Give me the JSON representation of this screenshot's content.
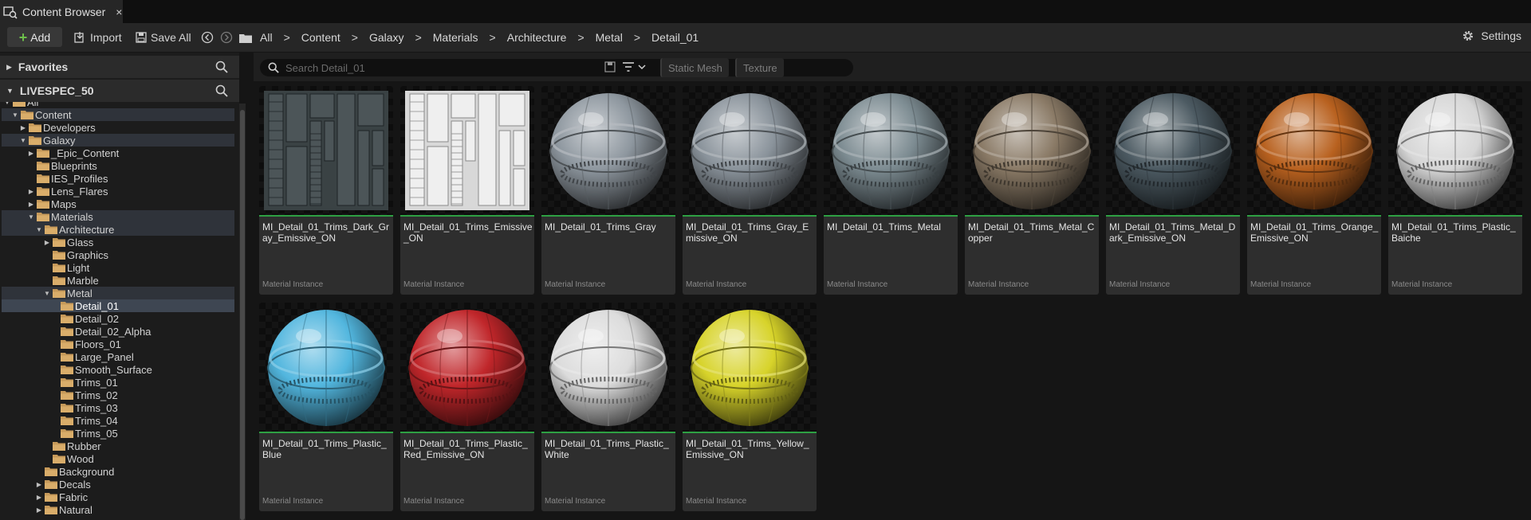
{
  "tab": {
    "label": "Content Browser",
    "close": "×"
  },
  "toolbar": {
    "add_label": "Add",
    "import_label": "Import",
    "save_all_label": "Save All",
    "settings_label": "Settings"
  },
  "breadcrumbs": [
    "All",
    "Content",
    "Galaxy",
    "Materials",
    "Architecture",
    "Metal",
    "Detail_01"
  ],
  "left_panel": {
    "favorites_label": "Favorites",
    "project_label": "LIVESPEC_50",
    "tree": [
      {
        "label": "All",
        "depth": 0,
        "arrow": "down",
        "highlight": false
      },
      {
        "label": "Content",
        "depth": 1,
        "arrow": "down",
        "highlight": true
      },
      {
        "label": "Developers",
        "depth": 2,
        "arrow": "right",
        "highlight": false
      },
      {
        "label": "Galaxy",
        "depth": 2,
        "arrow": "down",
        "highlight": true
      },
      {
        "label": "_Epic_Content",
        "depth": 3,
        "arrow": "right",
        "highlight": false
      },
      {
        "label": "Blueprints",
        "depth": 3,
        "arrow": "",
        "highlight": false
      },
      {
        "label": "IES_Profiles",
        "depth": 3,
        "arrow": "",
        "highlight": false
      },
      {
        "label": "Lens_Flares",
        "depth": 3,
        "arrow": "right",
        "highlight": false
      },
      {
        "label": "Maps",
        "depth": 3,
        "arrow": "right",
        "highlight": false
      },
      {
        "label": "Materials",
        "depth": 3,
        "arrow": "down",
        "highlight": true
      },
      {
        "label": "Architecture",
        "depth": 4,
        "arrow": "down",
        "highlight": true
      },
      {
        "label": "Glass",
        "depth": 5,
        "arrow": "right",
        "highlight": false
      },
      {
        "label": "Graphics",
        "depth": 5,
        "arrow": "",
        "highlight": false
      },
      {
        "label": "Light",
        "depth": 5,
        "arrow": "",
        "highlight": false
      },
      {
        "label": "Marble",
        "depth": 5,
        "arrow": "",
        "highlight": false
      },
      {
        "label": "Metal",
        "depth": 5,
        "arrow": "down",
        "highlight": true
      },
      {
        "label": "Detail_01",
        "depth": 6,
        "arrow": "",
        "highlight": false,
        "selected": true
      },
      {
        "label": "Detail_02",
        "depth": 6,
        "arrow": "",
        "highlight": false
      },
      {
        "label": "Detail_02_Alpha",
        "depth": 6,
        "arrow": "",
        "highlight": false
      },
      {
        "label": "Floors_01",
        "depth": 6,
        "arrow": "",
        "highlight": false
      },
      {
        "label": "Large_Panel",
        "depth": 6,
        "arrow": "",
        "highlight": false
      },
      {
        "label": "Smooth_Surface",
        "depth": 6,
        "arrow": "",
        "highlight": false
      },
      {
        "label": "Trims_01",
        "depth": 6,
        "arrow": "",
        "highlight": false
      },
      {
        "label": "Trims_02",
        "depth": 6,
        "arrow": "",
        "highlight": false
      },
      {
        "label": "Trims_03",
        "depth": 6,
        "arrow": "",
        "highlight": false
      },
      {
        "label": "Trims_04",
        "depth": 6,
        "arrow": "",
        "highlight": false
      },
      {
        "label": "Trims_05",
        "depth": 6,
        "arrow": "",
        "highlight": false
      },
      {
        "label": "Rubber",
        "depth": 5,
        "arrow": "",
        "highlight": false
      },
      {
        "label": "Wood",
        "depth": 5,
        "arrow": "",
        "highlight": false
      },
      {
        "label": "Background",
        "depth": 4,
        "arrow": "",
        "highlight": false
      },
      {
        "label": "Decals",
        "depth": 4,
        "arrow": "right",
        "highlight": false
      },
      {
        "label": "Fabric",
        "depth": 4,
        "arrow": "right",
        "highlight": false
      },
      {
        "label": "Natural",
        "depth": 4,
        "arrow": "right",
        "highlight": false
      }
    ]
  },
  "filters": {
    "search_placeholder": "Search Detail_01",
    "chips": [
      "Static Mesh",
      "Texture"
    ]
  },
  "assets": [
    {
      "name": "MI_Detail_01_Trims_Dark_Gray_Emissive_ON",
      "type": "Material Instance",
      "preview": "texture-dark",
      "color": "#3a4244"
    },
    {
      "name": "MI_Detail_01_Trims_Emissive_ON",
      "type": "Material Instance",
      "preview": "texture-light",
      "color": "#d8d8d8"
    },
    {
      "name": "MI_Detail_01_Trims_Gray",
      "type": "Material Instance",
      "preview": "sphere",
      "color": "#8e979f"
    },
    {
      "name": "MI_Detail_01_Trims_Gray_Emissive_ON",
      "type": "Material Instance",
      "preview": "sphere",
      "color": "#8a939b"
    },
    {
      "name": "MI_Detail_01_Trims_Metal",
      "type": "Material Instance",
      "preview": "sphere",
      "color": "#7d8c92"
    },
    {
      "name": "MI_Detail_01_Trims_Metal_Copper",
      "type": "Material Instance",
      "preview": "sphere",
      "color": "#8a7a66"
    },
    {
      "name": "MI_Detail_01_Trims_Metal_Dark_Emissive_ON",
      "type": "Material Instance",
      "preview": "sphere",
      "color": "#4c5a62"
    },
    {
      "name": "MI_Detail_01_Trims_Orange_Emissive_ON",
      "type": "Material Instance",
      "preview": "sphere",
      "color": "#b8611f"
    },
    {
      "name": "MI_Detail_01_Trims_Plastic_Baiche",
      "type": "Material Instance",
      "preview": "sphere",
      "color": "#d6d6d6"
    },
    {
      "name": "MI_Detail_01_Trims_Plastic_Blue",
      "type": "Material Instance",
      "preview": "sphere",
      "color": "#52b6de"
    },
    {
      "name": "MI_Detail_01_Trims_Plastic_Red_Emissive_ON",
      "type": "Material Instance",
      "preview": "sphere",
      "color": "#c0262a"
    },
    {
      "name": "MI_Detail_01_Trims_Plastic_White",
      "type": "Material Instance",
      "preview": "sphere",
      "color": "#dcdcdc"
    },
    {
      "name": "MI_Detail_01_Trims_Yellow_Emissive_ON",
      "type": "Material Instance",
      "preview": "sphere",
      "color": "#d7d32a"
    }
  ],
  "colors": {
    "accent_green": "#2ea043",
    "add_plus": "#6dbf4b",
    "folder": "#c79a5a"
  }
}
